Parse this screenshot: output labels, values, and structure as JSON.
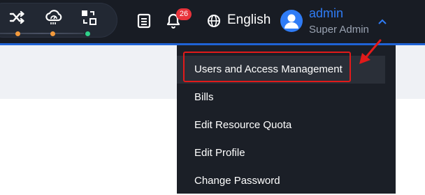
{
  "header": {
    "notification_count": "26",
    "language": "English",
    "user": {
      "name": "admin",
      "role": "Super Admin"
    }
  },
  "colors": {
    "topbar": "#181c24",
    "accent": "#1f63d6",
    "badge": "#e8333b",
    "username": "#2f7cf6",
    "annotation": "#e11a1a",
    "status_dots": [
      "#f39a3c",
      "#f39a3c",
      "#2fd18a"
    ]
  },
  "icons": {
    "monitor": [
      "shuffle-icon",
      "cloud-gauge-icon",
      "switch-icon"
    ],
    "notes": "clipboard-list-icon",
    "notifications": "bell-icon",
    "language": "globe-icon",
    "avatar": "user-avatar-icon",
    "dropdown_toggle": "chevron-up-icon"
  },
  "dropdown": {
    "open": true,
    "items": [
      {
        "label": "Users and Access Management",
        "active": true
      },
      {
        "label": "Bills"
      },
      {
        "label": "Edit Resource Quota"
      },
      {
        "label": "Edit Profile"
      },
      {
        "label": "Change Password"
      }
    ]
  }
}
